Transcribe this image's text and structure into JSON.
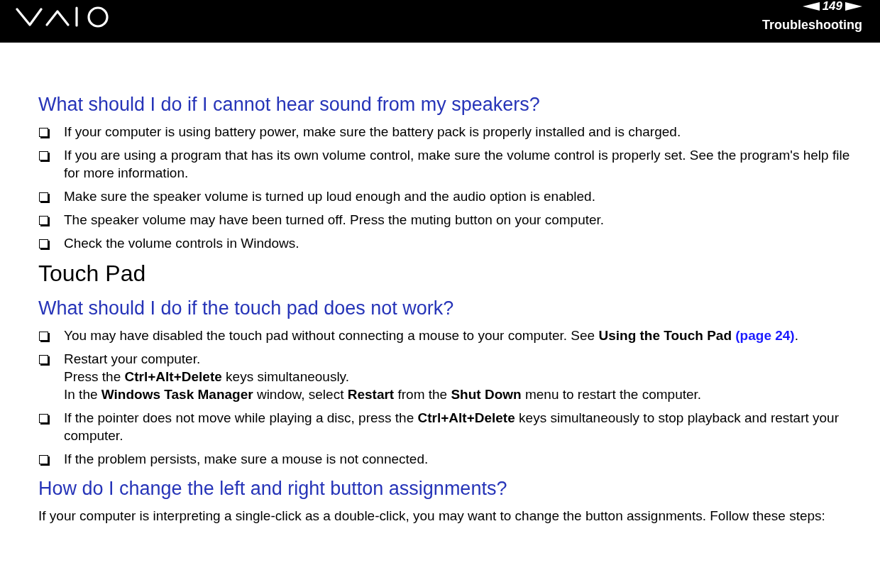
{
  "header": {
    "page_number": "149",
    "section": "Troubleshooting"
  },
  "blocks": [
    {
      "kind": "question",
      "text": "What should I do if I cannot hear sound from my speakers?"
    },
    {
      "kind": "bullets",
      "items": [
        {
          "lines": [
            "If your computer is using battery power, make sure the battery pack is properly installed and is charged."
          ]
        },
        {
          "lines": [
            "If you are using a program that has its own volume control, make sure the volume control is properly set. See the program's help file for more information."
          ]
        },
        {
          "lines": [
            "Make sure the speaker volume is turned up loud enough and the audio option is enabled."
          ]
        },
        {
          "lines": [
            "The speaker volume may have been turned off. Press the muting button on your computer."
          ]
        },
        {
          "lines": [
            "Check the volume controls in Windows."
          ]
        }
      ]
    },
    {
      "kind": "section",
      "text": "Touch Pad"
    },
    {
      "kind": "question",
      "text": "What should I do if the touch pad does not work?"
    },
    {
      "kind": "bullets",
      "items": [
        {
          "lines": [
            "You may have disabled the touch pad without connecting a mouse to your computer. See **Using the Touch Pad**"
          ],
          "link": "(page 24)",
          "tail": "."
        },
        {
          "lines": [
            "Restart your computer.",
            "Press the **Ctrl+Alt+Delete** keys simultaneously.",
            "In the **Windows Task Manager** window, select **Restart** from the **Shut Down** menu to restart the computer."
          ]
        },
        {
          "lines": [
            "If the pointer does not move while playing a disc, press the **Ctrl+Alt+Delete** keys simultaneously to stop playback and restart your computer."
          ]
        },
        {
          "lines": [
            "If the problem persists, make sure a mouse is not connected."
          ]
        }
      ]
    },
    {
      "kind": "question",
      "text": "How do I change the left and right button assignments?"
    },
    {
      "kind": "paragraph",
      "text": "If your computer is interpreting a single-click as a double-click, you may want to change the button assignments. Follow these steps:"
    }
  ]
}
